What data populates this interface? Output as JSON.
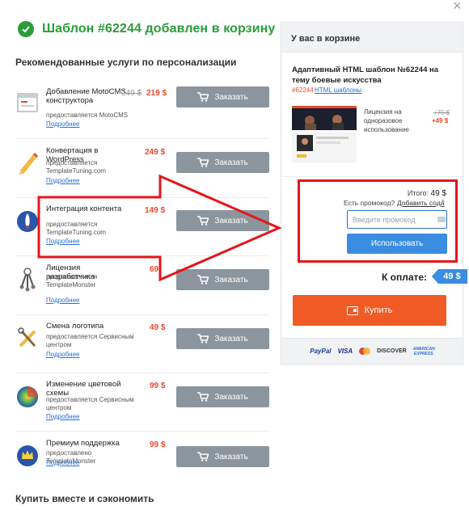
{
  "header": {
    "close_glyph": "×",
    "added_message": "Шаблон #62244 добавлен в корзину",
    "recommended_title": "Рекомендованные услуги по персонализации",
    "bundle_title": "Купить вместе и сэкономить"
  },
  "services": [
    {
      "name": "Добавление MotoCMS конструктора",
      "provider": "предоставляется MotoCMS",
      "more": "Подробнее",
      "old_price": "249 $",
      "price": "219 $",
      "button": "Заказать",
      "icon": "motocms-icon"
    },
    {
      "name": "Конвертация в WordPress",
      "provider": "предоставляется TemplateTuning.com",
      "more": "Подробнее",
      "old_price": "",
      "price": "249 $",
      "button": "Заказать",
      "icon": "pencil-icon"
    },
    {
      "name": "Интеграция контента",
      "provider": "предоставляется TemplateTuning.com",
      "more": "Подробнее",
      "old_price": "",
      "price": "149 $",
      "button": "Заказать",
      "icon": "rocket-icon"
    },
    {
      "name": "Лицензия разработчика",
      "provider": "предоставляется TemplateMonster",
      "more": "Подробнее",
      "old_price": "",
      "price": "69",
      "button": "Заказать",
      "icon": "keys-icon"
    },
    {
      "name": "Смена логотипа",
      "provider": "предоставляется Сервисным центром",
      "more": "Подробнее",
      "old_price": "",
      "price": "49 $",
      "button": "Заказать",
      "icon": "tools-icon"
    },
    {
      "name": "Изменение цветовой схемы",
      "provider": "предоставляется Сервисным центром",
      "more": "Подробнее",
      "old_price": "",
      "price": "99 $",
      "button": "Заказать",
      "icon": "color-wheel-icon"
    },
    {
      "name": "Премиум поддержка",
      "provider": "предоставлено TemplateMonster",
      "more": "Подробнее",
      "old_price": "",
      "price": "99 $",
      "button": "Заказать",
      "icon": "crown-icon"
    }
  ],
  "cart": {
    "title": "У вас в корзине",
    "item_title": "Адаптивный HTML шаблон №62244 на тему боевые искусства",
    "item_id": "#62244",
    "item_category": "HTML шаблоны",
    "license_text": "Лицензия на одноразовое использование",
    "license_old": "+75 $",
    "license_price": "+49 $",
    "total_label": "Итого:",
    "total_value": "49 $",
    "promo_question": "Есть промокод?",
    "promo_add": "Добавить сода",
    "promo_caret": "^",
    "promo_placeholder": "Введите промокод",
    "use_button": "Использовать",
    "pay_label": "К оплате:",
    "pay_value": "49 $",
    "buy_button": "Купить",
    "payment_methods": [
      "PayPal",
      "VISA",
      "MasterCard",
      "DISCOVER",
      "AMERICAN EXPRESS"
    ]
  },
  "colors": {
    "success": "#2a9d3a",
    "price": "#e9492d",
    "order_button": "#8b959d",
    "accent_blue": "#3a8de0",
    "buy_orange": "#f05a24",
    "annotation_red": "#e4161c"
  }
}
